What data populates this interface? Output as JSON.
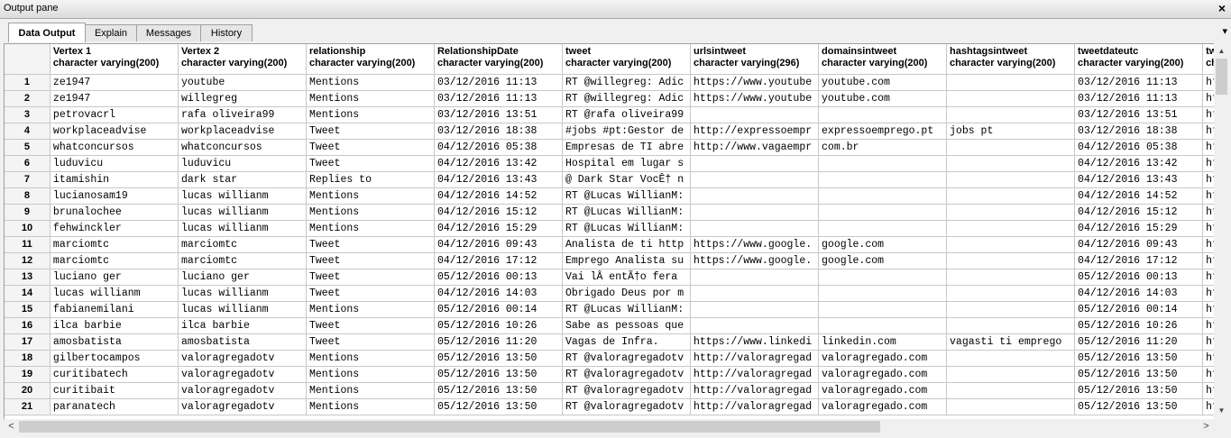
{
  "pane": {
    "title": "Output pane",
    "close": "×",
    "menu": "▾"
  },
  "tabs": [
    {
      "label": "Data Output",
      "active": true
    },
    {
      "label": "Explain"
    },
    {
      "label": "Messages"
    },
    {
      "label": "History"
    }
  ],
  "columns": [
    {
      "name": "Vertex 1",
      "type": "character varying(200)"
    },
    {
      "name": "Vertex 2",
      "type": "character varying(200)"
    },
    {
      "name": "relationship",
      "type": "character varying(200)"
    },
    {
      "name": "RelationshipDate",
      "type": "character varying(200)"
    },
    {
      "name": "tweet",
      "type": "character varying(200)"
    },
    {
      "name": "urlsintweet",
      "type": "character varying(296)"
    },
    {
      "name": "domainsintweet",
      "type": "character varying(200)"
    },
    {
      "name": "hashtagsintweet",
      "type": "character varying(200)"
    },
    {
      "name": "tweetdateutc",
      "type": "character varying(200)"
    },
    {
      "name": "twitterp",
      "type": "characte"
    }
  ],
  "rows": [
    [
      "1",
      "ze1947",
      "youtube",
      "Mentions",
      "03/12/2016 11:13",
      "RT @willegreg: Adic",
      "https://www.youtube",
      "youtube.com",
      "",
      "03/12/2016 11:13",
      "https:/"
    ],
    [
      "2",
      "ze1947",
      "willegreg",
      "Mentions",
      "03/12/2016 11:13",
      "RT @willegreg: Adic",
      "https://www.youtube",
      "youtube.com",
      "",
      "03/12/2016 11:13",
      "https:/"
    ],
    [
      "3",
      "petrovacrl",
      "rafa oliveira99",
      "Mentions",
      "03/12/2016 13:51",
      "RT @rafa oliveira99",
      "",
      "",
      "",
      "03/12/2016 13:51",
      "https:/"
    ],
    [
      "4",
      "workplaceadvise",
      "workplaceadvise",
      "Tweet",
      "03/12/2016 18:38",
      "#jobs #pt:Gestor de",
      "http://expressoempr",
      "expressoemprego.pt",
      "jobs pt",
      "03/12/2016 18:38",
      "https:/"
    ],
    [
      "5",
      "whatconcursos",
      "whatconcursos",
      "Tweet",
      "04/12/2016 05:38",
      "Empresas de TI abre",
      "http://www.vagaempr",
      "com.br",
      "",
      "04/12/2016 05:38",
      "https:/"
    ],
    [
      "6",
      "luduvicu",
      "luduvicu",
      "Tweet",
      "04/12/2016 13:42",
      "Hospital em lugar s",
      "",
      "",
      "",
      "04/12/2016 13:42",
      "https:/"
    ],
    [
      "7",
      "itamishin",
      " dark star",
      "Replies to",
      "04/12/2016 13:43",
      "@ Dark Star VocÊ† n",
      "",
      "",
      "",
      "04/12/2016 13:43",
      "https:/"
    ],
    [
      "8",
      "lucianosam19",
      "lucas willianm",
      "Mentions",
      "04/12/2016 14:52",
      "RT @Lucas WillianM:",
      "",
      "",
      "",
      "04/12/2016 14:52",
      "https:/"
    ],
    [
      "9",
      "brunalochee",
      "lucas willianm",
      "Mentions",
      "04/12/2016 15:12",
      "RT @Lucas WillianM:",
      "",
      "",
      "",
      "04/12/2016 15:12",
      "https:/"
    ],
    [
      "10",
      "fehwinckler",
      "lucas willianm",
      "Mentions",
      "04/12/2016 15:29",
      "RT @Lucas WillianM:",
      "",
      "",
      "",
      "04/12/2016 15:29",
      "https:/"
    ],
    [
      "11",
      "marciomtc",
      "marciomtc",
      "Tweet",
      "04/12/2016 09:43",
      "Analista de ti http",
      "https://www.google.",
      "google.com",
      "",
      "04/12/2016 09:43",
      "https:/"
    ],
    [
      "12",
      "marciomtc",
      "marciomtc",
      "Tweet",
      "04/12/2016 17:12",
      "Emprego Analista su",
      "https://www.google.",
      "google.com",
      "",
      "04/12/2016 17:12",
      "https:/"
    ],
    [
      "13",
      "luciano ger",
      "luciano ger",
      "Tweet",
      "05/12/2016 00:13",
      "Vai lÂ  entÃ†o fera",
      "",
      "",
      "",
      "05/12/2016 00:13",
      "https:/"
    ],
    [
      "14",
      "lucas willianm",
      "lucas willianm",
      "Tweet",
      "04/12/2016 14:03",
      "Obrigado Deus por m",
      "",
      "",
      "",
      "04/12/2016 14:03",
      "https:/"
    ],
    [
      "15",
      "fabianemilani",
      "lucas willianm",
      "Mentions",
      "05/12/2016 00:14",
      "RT @Lucas WillianM:",
      "",
      "",
      "",
      "05/12/2016 00:14",
      "https:/"
    ],
    [
      "16",
      "ilca barbie",
      "ilca barbie",
      "Tweet",
      "05/12/2016 10:26",
      "Sabe as pessoas que",
      "",
      "",
      "",
      "05/12/2016 10:26",
      "https:/"
    ],
    [
      "17",
      "amosbatista",
      "amosbatista",
      "Tweet",
      "05/12/2016 11:20",
      "Vagas de Infra.",
      "https://www.linkedi",
      "linkedin.com",
      "vagasti ti emprego",
      "05/12/2016 11:20",
      "https:/"
    ],
    [
      "18",
      "gilbertocampos",
      "valoragregadotv",
      "Mentions",
      "05/12/2016 13:50",
      "RT @valoragregadotv",
      "http://valoragregad",
      "valoragregado.com",
      "",
      "05/12/2016 13:50",
      "https:/"
    ],
    [
      "19",
      "curitibatech",
      "valoragregadotv",
      "Mentions",
      "05/12/2016 13:50",
      "RT @valoragregadotv",
      "http://valoragregad",
      "valoragregado.com",
      "",
      "05/12/2016 13:50",
      "https:/"
    ],
    [
      "20",
      "curitibait",
      "valoragregadotv",
      "Mentions",
      "05/12/2016 13:50",
      "RT @valoragregadotv",
      "http://valoragregad",
      "valoragregado.com",
      "",
      "05/12/2016 13:50",
      "https:/"
    ],
    [
      "21",
      "paranatech",
      "valoragregadotv",
      "Mentions",
      "05/12/2016 13:50",
      "RT @valoragregadotv",
      "http://valoragregad",
      "valoragregado.com",
      "",
      "05/12/2016 13:50",
      "https:/"
    ]
  ],
  "scroll": {
    "up": "▲",
    "down": "▼",
    "left": "<",
    "right": ">"
  }
}
